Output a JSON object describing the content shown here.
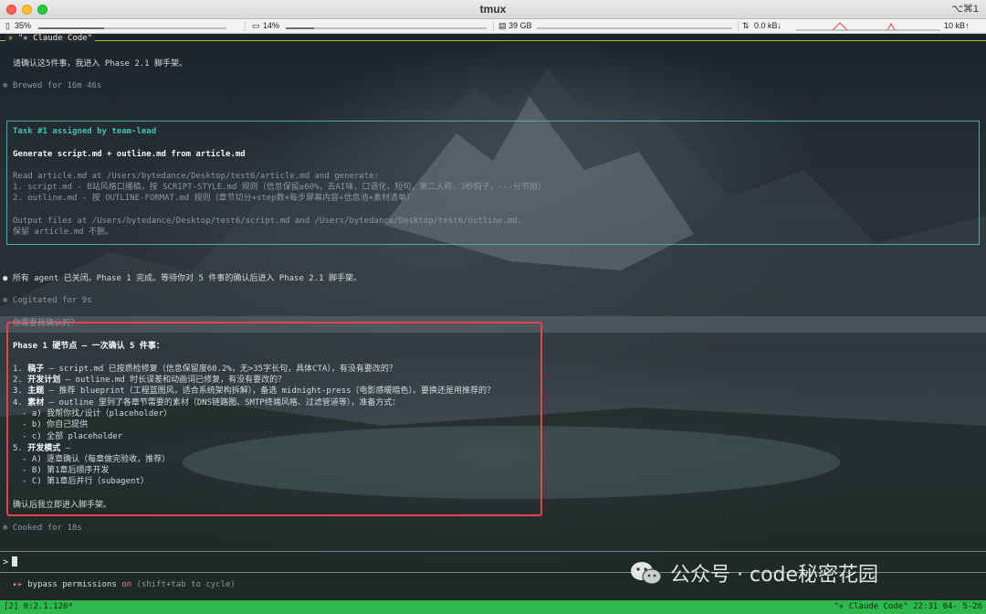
{
  "window": {
    "title": "tmux",
    "shortcut": "⌥⌘1"
  },
  "stats": {
    "cpu": "35%",
    "cpu_level": 0.35,
    "mem": "14%",
    "mem_level": 0.14,
    "disk": "39 GB",
    "net_down": "0.0 kB↓",
    "net_up": "10 kB↑"
  },
  "pane": {
    "title": "\"✳ Claude Code\"",
    "mark": "✳"
  },
  "conversation": {
    "line1": "请确认这5件事，我进入 Phase 2.1 脚手架。",
    "brewed": "✻ Brewed for 16m 46s",
    "task": {
      "header": "Task #1 assigned by team-lead",
      "title": "Generate script.md + outline.md from article.md",
      "read": "Read article.md at /Users/bytedance/Desktop/test6/article.md and generate:",
      "item1": "1. script.md - B站风格口播稿，按 SCRIPT-STYLE.md 规则（信息保留≥60%，去AI味，口语化，短句，第二人称，3秒钩子，---分节拍）",
      "item2": "2. outline.md - 按 OUTLINE-FORMAT.md 规则（章节切分+step数+每步屏幕内容+信息池+素材清单）",
      "output": "Output files at /Users/bytedance/Desktop/test6/script.md and /Users/bytedance/Desktop/test6/outline.md.",
      "keep": "保留 article.md 不删。"
    },
    "agents_line": "● 所有 agent 已关闭。Phase 1 完成。等待你对 5 件事的确认后进入 Phase 2.1 脚手架。",
    "cogitated": "✻ Cogitated for 9s",
    "ask_label": "你需要我确认的？",
    "phase_title": "Phase 1 硬节点 — 一次确认 5 件事：",
    "items": [
      {
        "num": "1. ",
        "key": "稿子",
        "text": " — script.md 已按质检修复（信息保留度60.2%，无>35字长句，具体CTA），有没有要改的？"
      },
      {
        "num": "2. ",
        "key": "开发计划",
        "text": " — outline.md 时长误差和动画词已修复，有没有要改的？"
      },
      {
        "num": "3. ",
        "key": "主题",
        "text": " — 推荐 blueprint（工程蓝图风，适合系统架构拆解），备选 midnight-press（电影感暖暗色）。要换还是用推荐的？"
      },
      {
        "num": "4. ",
        "key": "素材",
        "text": " — outline 里列了各章节需要的素材（DNS链路图、SMTP终端风格、过滤管道等），准备方式："
      }
    ],
    "sub4": [
      "- a) 我帮你找/设计（placeholder）",
      "- b) 你自己提供",
      "- c) 全部 placeholder"
    ],
    "item5": {
      "num": "5. ",
      "key": "开发模式",
      "text": " —"
    },
    "sub5": [
      "- A) 逐章确认（每章做完验收，推荐）",
      "- B) 第1章后顺序开发",
      "- C) 第1章后并行（subagent）"
    ],
    "confirm": "确认后我立即进入脚手架。",
    "cooked": "✻ Cooked for 18s"
  },
  "input": {
    "prompt": ">"
  },
  "permissions": {
    "arrows": "▸▸",
    "text": " bypass permissions ",
    "state": "on",
    "hint": " (shift+tab to cycle)"
  },
  "statusbar": {
    "left": "[2] 0:2.1.126*",
    "right": "\"✳ Claude Code\" 22:31 04- 5-26"
  },
  "watermark": {
    "text": "公众号 · code秘密花园"
  }
}
